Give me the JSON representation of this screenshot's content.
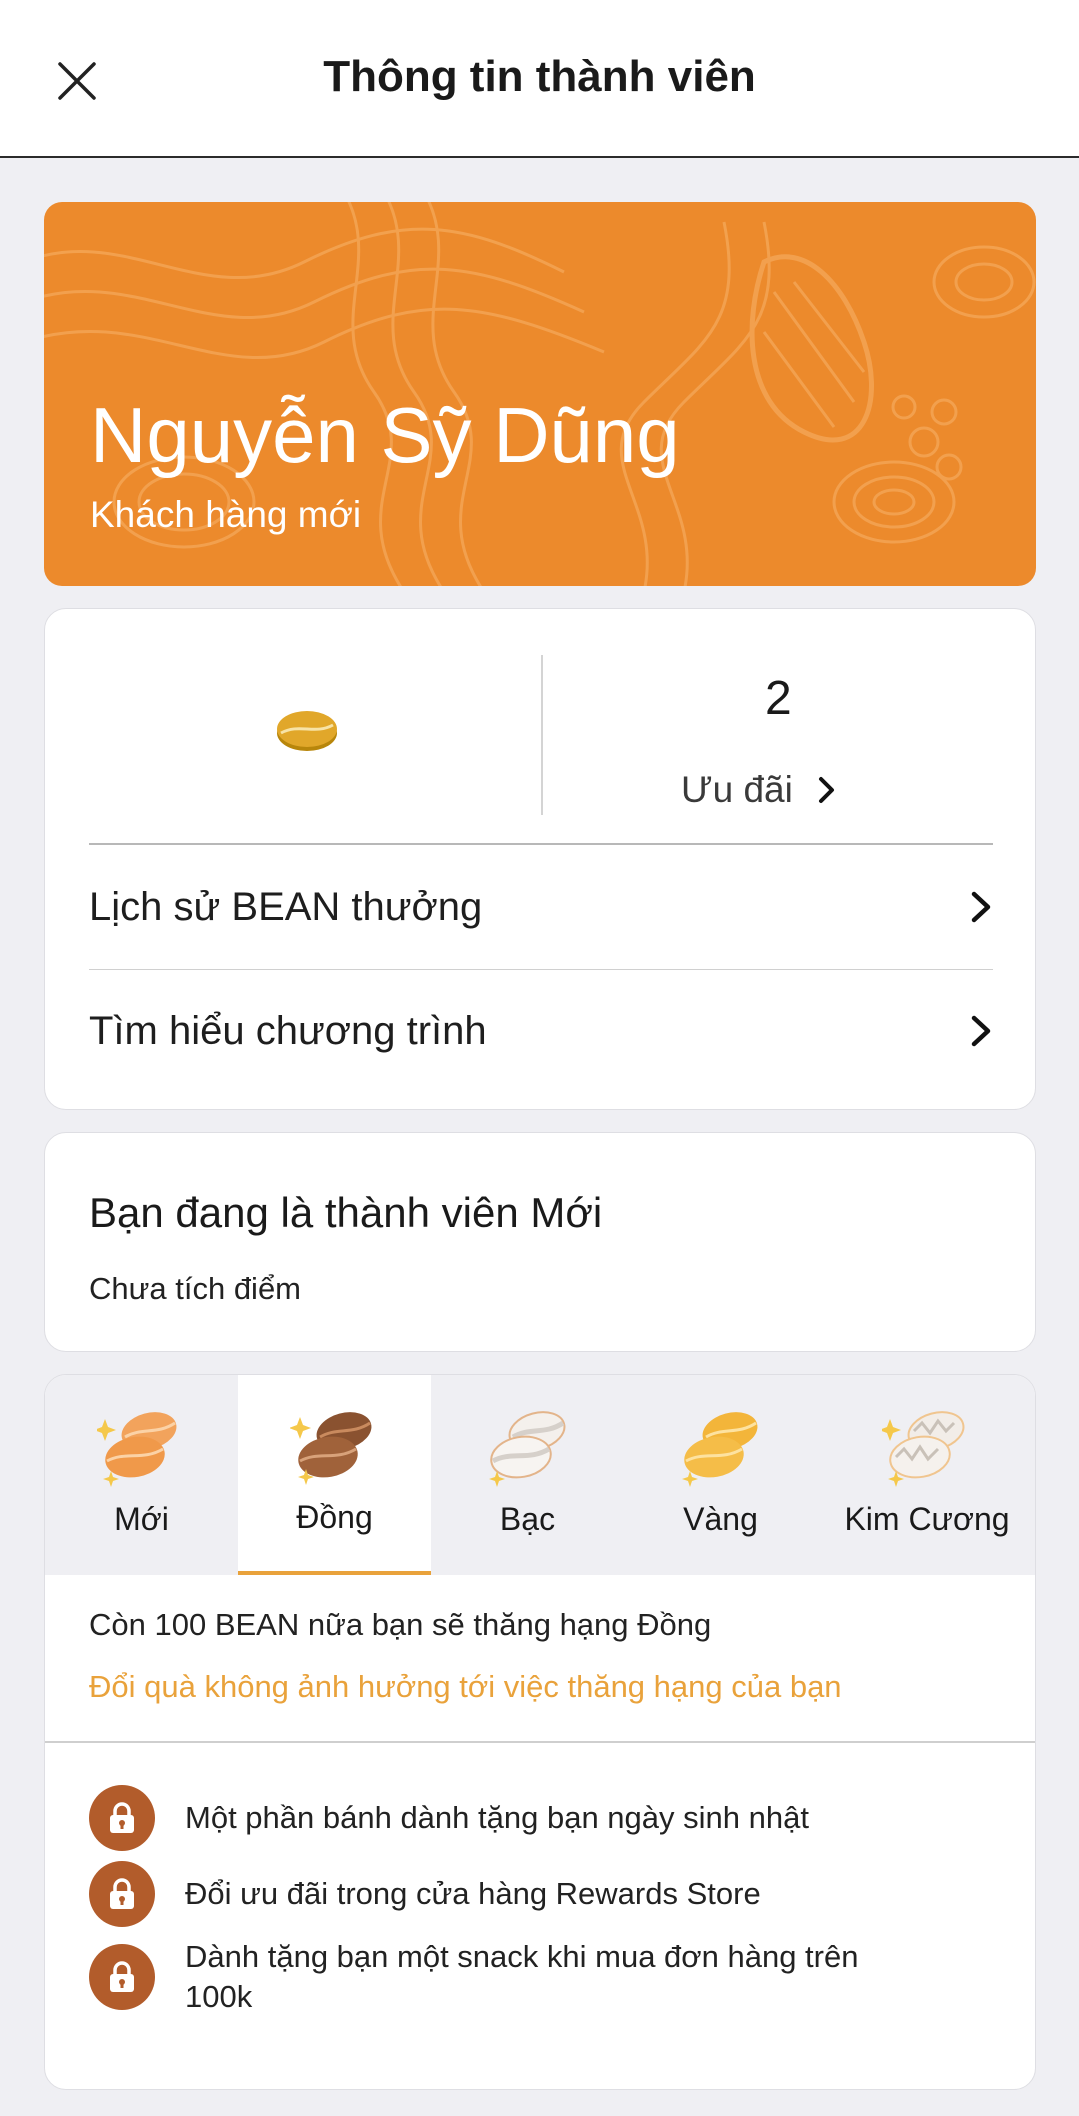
{
  "header": {
    "title": "Thông tin thành viên",
    "close_icon": "close-icon"
  },
  "profile": {
    "name": "Nguyễn Sỹ Dũng",
    "tier": "Khách hàng mới",
    "accent": "#ec8a2c"
  },
  "stats": {
    "bean_icon": "coffee-bean-icon",
    "offers_count": "2",
    "offers_label": "Ưu đãi",
    "links": [
      {
        "label": "Lịch sử BEAN thưởng"
      },
      {
        "label": "Tìm hiểu chương trình"
      }
    ]
  },
  "membership": {
    "heading": "Bạn đang là thành viên Mới",
    "points_status": "Chưa tích điểm"
  },
  "tiers": {
    "tabs": [
      {
        "label": "Mới",
        "icon": "new-tier-beans-icon"
      },
      {
        "label": "Đồng",
        "icon": "bronze-tier-beans-icon"
      },
      {
        "label": "Bạc",
        "icon": "silver-tier-beans-icon"
      },
      {
        "label": "Vàng",
        "icon": "gold-tier-beans-icon"
      },
      {
        "label": "Kim Cương",
        "icon": "diamond-tier-beans-icon"
      }
    ],
    "selected": "Đồng",
    "upgrade_text": "Còn 100 BEAN nữa bạn sẽ thăng hạng Đồng",
    "note": "Đổi quà không ảnh hưởng tới việc thăng hạng của bạn",
    "note_color": "#e9a23b",
    "benefits": [
      {
        "text": "Một phần bánh dành tặng bạn ngày sinh nhật"
      },
      {
        "text": "Đổi ưu đãi trong cửa hàng Rewards Store"
      },
      {
        "text": "Dành tặng bạn một snack khi mua đơn hàng trên 100k"
      }
    ]
  }
}
